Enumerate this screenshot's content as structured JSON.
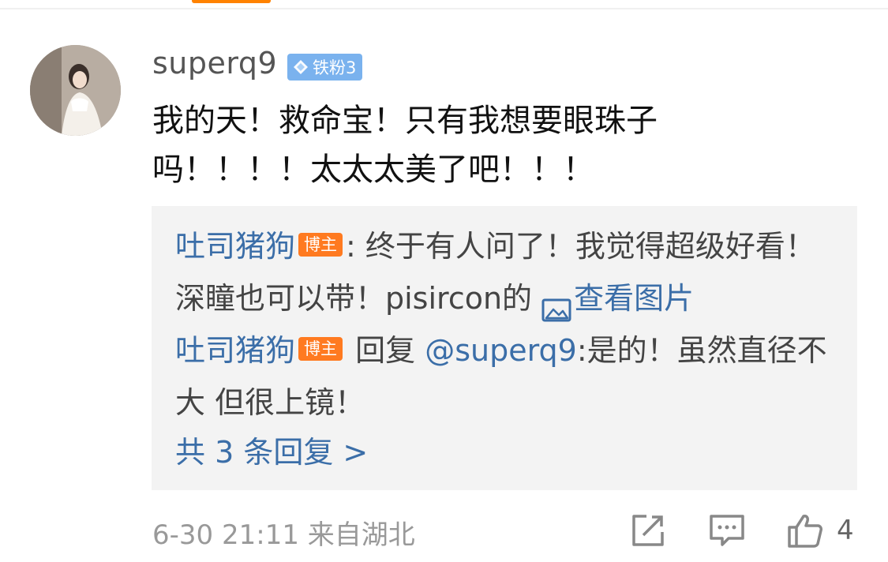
{
  "comment": {
    "username": "superq9",
    "fan_badge": "铁粉3",
    "text": "我的天！救命宝！只有我想要眼珠子吗！！！！太太太美了吧！！！",
    "time": "6-30 21:11",
    "location": "来自湖北",
    "like_count": "4"
  },
  "replies": [
    {
      "user": "吐司猪狗",
      "badge": "博主",
      "separator": ":",
      "text": "终于有人问了！我觉得超级好看！深瞳也可以带！pisircon的",
      "link_text": "查看图片"
    },
    {
      "user": "吐司猪狗",
      "badge": "博主",
      "prefix": "回复",
      "mention": "@superq9",
      "text": ":是的！虽然直径不大 但很上镜！"
    }
  ],
  "more_replies": "共 3 条回复 >",
  "icons": {
    "fan_badge": "diamond-icon",
    "image_link": "image-icon",
    "share": "share-icon",
    "comment": "comment-icon",
    "like": "thumbs-up-icon"
  },
  "colors": {
    "accent_orange": "#ff8200",
    "link_blue": "#3b6ea8",
    "fan_badge_blue": "#7ab2ee",
    "blogger_badge_orange": "#ff7a20",
    "reply_bg": "#f3f3f3"
  }
}
